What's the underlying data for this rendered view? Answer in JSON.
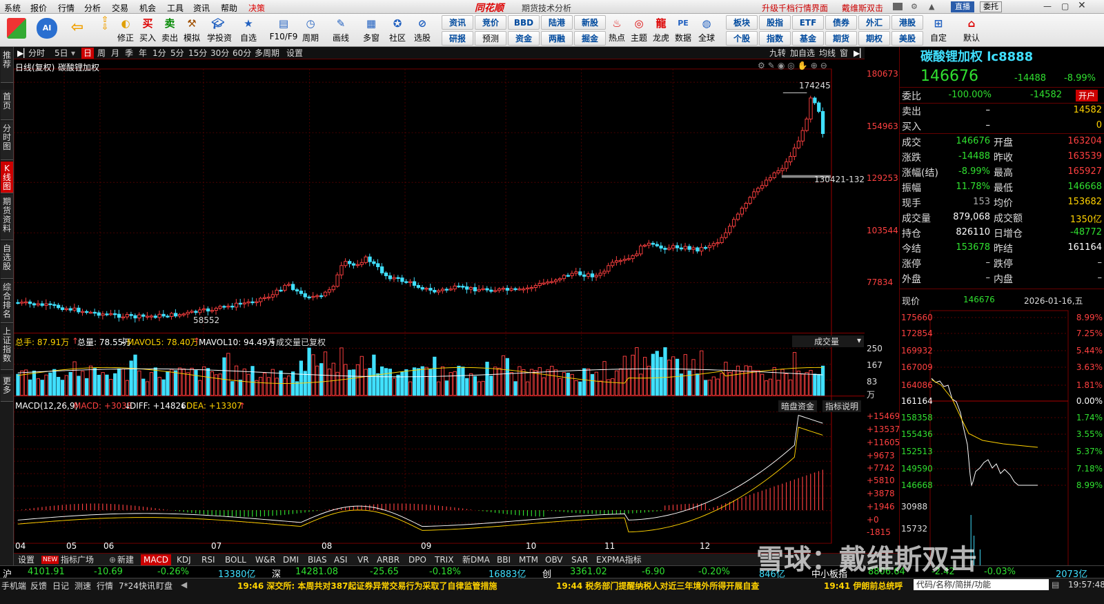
{
  "menubar": {
    "items": [
      "系统",
      "报价",
      "行情",
      "分析",
      "交易",
      "机会",
      "工具",
      "资讯",
      "帮助",
      "决策"
    ],
    "brand": "同花顺",
    "title": "期货技术分析",
    "upgrade": "升级千档行情界面",
    "user": "戴维斯双击",
    "right_btn1": "直播",
    "right_btn2": "委托"
  },
  "toolbar": {
    "buttons": [
      {
        "label": "",
        "icon": "grid"
      },
      {
        "label": "",
        "icon": "ai"
      },
      {
        "label": "",
        "icon": "back"
      },
      {
        "label": "修正"
      },
      {
        "label": "买入"
      },
      {
        "label": "卖出"
      },
      {
        "label": "模拟"
      },
      {
        "label": "学投资"
      },
      {
        "label": "自选"
      },
      {
        "label": "F10/F9"
      },
      {
        "label": "周期"
      },
      {
        "label": "画线"
      },
      {
        "label": "多窗"
      },
      {
        "label": "社区"
      },
      {
        "label": "选股"
      }
    ],
    "pairs": [
      [
        "资讯",
        "研报"
      ],
      [
        "竞价",
        "预测"
      ],
      [
        "BBD",
        "资金"
      ],
      [
        "陆港",
        "两融"
      ],
      [
        "新股",
        "掘金"
      ]
    ],
    "buttons2": [
      {
        "label": "热点"
      },
      {
        "label": "主题"
      },
      {
        "label": "龙虎"
      },
      {
        "label": "数据"
      },
      {
        "label": "全球"
      }
    ],
    "pairs2": [
      [
        "板块",
        "个股"
      ],
      [
        "股指",
        "指数"
      ],
      [
        "ETF",
        "基金"
      ],
      [
        "债券",
        "期货"
      ],
      [
        "外汇",
        "期权"
      ],
      [
        "港股",
        "美股"
      ]
    ],
    "buttons3": [
      {
        "label": "自定"
      },
      {
        "label": "默认"
      }
    ]
  },
  "sidebar": [
    "推荐",
    "首页",
    "分时图",
    "K线图",
    "期货资料",
    "自选股",
    "综合排名",
    "上证指数",
    "更多"
  ],
  "periods": [
    "分时",
    "5日",
    "日",
    "周",
    "月",
    "季",
    "年",
    "1分",
    "5分",
    "15分",
    "30分",
    "60分",
    "多周期",
    "设置"
  ],
  "period_right": [
    "九转",
    "加自选",
    "均线",
    "窗"
  ],
  "chart_header": {
    "mode": "日线(复权)",
    "name": "碳酸锂加权"
  },
  "price_axis": [
    "180673",
    "154963",
    "129253",
    "103544",
    "77834"
  ],
  "annotations": {
    "high": "174245",
    "low": "58552",
    "line": "130421-132"
  },
  "volume_header": {
    "total": "总手: 87.91万",
    "vol": "总量: 78.55万",
    "mavol5": "MAVOL5: 78.40万",
    "mavol10": "MAVOL10: 94.49万",
    "note": "成交量已复权",
    "selector": "成交量"
  },
  "volume_axis": [
    "250",
    "167",
    "83",
    "万"
  ],
  "macd_header": {
    "title": "MACD(12,26,9)",
    "macd": "MACD: +3038",
    "diff": "DIFF: +14826",
    "dea": "DEA: +13307",
    "btn1": "暗盘资金",
    "btn2": "指标说明"
  },
  "macd_axis": [
    "+15469",
    "+13537",
    "+11605",
    "+9673",
    "+7742",
    "+5810",
    "+3878",
    "+1946",
    "+0",
    "-1815"
  ],
  "months": [
    "04",
    "05",
    "06",
    "07",
    "08",
    "09",
    "10",
    "11",
    "12"
  ],
  "quote": {
    "title": "碳酸锂加权 lc8888",
    "price": "146676",
    "change": "-14488",
    "pct": "-8.99%",
    "weibi_label": "委比",
    "weibi": "-100.00%",
    "weicha": "-14582",
    "open_label": "开户",
    "sell_label": "卖出",
    "sell_price": "–",
    "sell_vol": "14582",
    "buy_label": "买入",
    "buy_price": "–",
    "buy_vol": "0",
    "rows": [
      [
        "成交",
        "146676",
        "开盘",
        "163204"
      ],
      [
        "涨跌",
        "-14488",
        "昨收",
        "163539"
      ],
      [
        "涨幅(结)",
        "-8.99%",
        "最高",
        "165927"
      ],
      [
        "振幅",
        "11.78%",
        "最低",
        "146668"
      ],
      [
        "现手",
        "153",
        "均价",
        "153682"
      ],
      [
        "成交量",
        "879,068",
        "成交额",
        "1350亿"
      ],
      [
        "持仓",
        "826110",
        "日增仓",
        "-48772"
      ],
      [
        "今结",
        "153678",
        "昨结",
        "161164"
      ],
      [
        "涨停",
        "–",
        "跌停",
        "–"
      ],
      [
        "外盘",
        "–",
        "内盘",
        "–"
      ]
    ],
    "cur_label": "现价",
    "cur": "146676",
    "date": "2026-01-16,五"
  },
  "mini_chart": {
    "left_axis": [
      "175660",
      "172854",
      "169932",
      "167009",
      "164086",
      "161164",
      "158358",
      "155436",
      "152513",
      "149590",
      "146668",
      "30988",
      "15732"
    ],
    "right_axis": [
      "8.99%",
      "7.25%",
      "5.44%",
      "3.63%",
      "1.81%",
      "0.00%",
      "1.74%",
      "3.55%",
      "5.37%",
      "7.18%",
      "8.99%"
    ]
  },
  "tabs": [
    "设置",
    "指标广场",
    "新建",
    "MACD",
    "KDJ",
    "RSI",
    "BOLL",
    "W&R",
    "DMI",
    "BIAS",
    "ASI",
    "VR",
    "ARBR",
    "DPO",
    "TRIX",
    "新DMA",
    "BBI",
    "MTM",
    "OBV",
    "SAR",
    "EXPMA指标"
  ],
  "tab_new_badge": "NEW",
  "index_bar": [
    {
      "name": "沪",
      "value": "4101.91",
      "chg": "-10.69",
      "pct": "-0.26%",
      "amt": "13380亿"
    },
    {
      "name": "深",
      "value": "14281.08",
      "chg": "-25.65",
      "pct": "-0.18%",
      "amt": "16883亿"
    },
    {
      "name": "创",
      "value": "3361.02",
      "chg": "-6.90",
      "pct": "-0.20%",
      "amt": "846亿"
    },
    {
      "name": "中小板指",
      "value": "8806.64",
      "chg": "-2.42",
      "pct": "-0.03%",
      "amt": "2073亿"
    }
  ],
  "status": {
    "left": [
      "手机端",
      "反馈",
      "日记",
      "测速",
      "行情",
      "7*24快讯",
      "盯盘"
    ],
    "news1": "19:46 深交所: 本周共对387起证券异常交易行为采取了自律监管措施",
    "news2": "19:44 税务部门提醒纳税人对近三年境外所得开展自查",
    "news3": "19:41 伊朗前总统呼",
    "search": "代码/名称/简拼/功能",
    "time": "19:57:48"
  },
  "watermark": "雪球：戴维斯双击",
  "colors": {
    "up": "#ff4040",
    "down": "#40e0ff",
    "text_green": "#30e030",
    "yellow": "#ffd200",
    "accent": "#cc0000"
  }
}
